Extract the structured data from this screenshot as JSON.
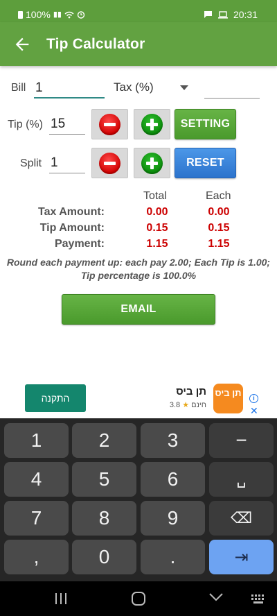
{
  "status_bar": {
    "battery": "100%",
    "time": "20:31"
  },
  "app_bar": {
    "title": "Tip Calculator"
  },
  "form": {
    "bill_label": "Bill",
    "bill_value": "1",
    "tax_label": "Tax (%)",
    "tip_label": "Tip (%)",
    "tip_value": "15",
    "split_label": "Split",
    "split_value": "1",
    "setting_button": "SETTING",
    "reset_button": "RESET"
  },
  "results": {
    "col_total": "Total",
    "col_each": "Each",
    "rows": [
      {
        "label": "Tax Amount:",
        "total": "0.00",
        "each": "0.00"
      },
      {
        "label": "Tip Amount:",
        "total": "0.15",
        "each": "0.15"
      },
      {
        "label": "Payment:",
        "total": "1.15",
        "each": "1.15"
      }
    ],
    "summary_line1": "Round each payment up: each pay 2.00; Each Tip is 1.00;",
    "summary_line2": "Tip percentage is 100.0%",
    "value_color": "#cc0000"
  },
  "email_button": "EMAIL",
  "ad": {
    "install_label": "התקנה",
    "app_name": "תן ביס",
    "rating": "3.8",
    "price": "חינם",
    "logo_text": "תן ביס"
  },
  "keyboard": {
    "keys": [
      "1",
      "2",
      "3",
      "−",
      "4",
      "5",
      "6",
      "␣",
      "7",
      "8",
      "9",
      "⌫",
      ",",
      "0",
      ".",
      "⇥"
    ]
  },
  "colors": {
    "appbar": "#62a241",
    "statusbar": "#5d9e3c",
    "green_button": "#4f9f31",
    "blue_button": "#2f7ad3",
    "ad_install": "#14866d"
  }
}
